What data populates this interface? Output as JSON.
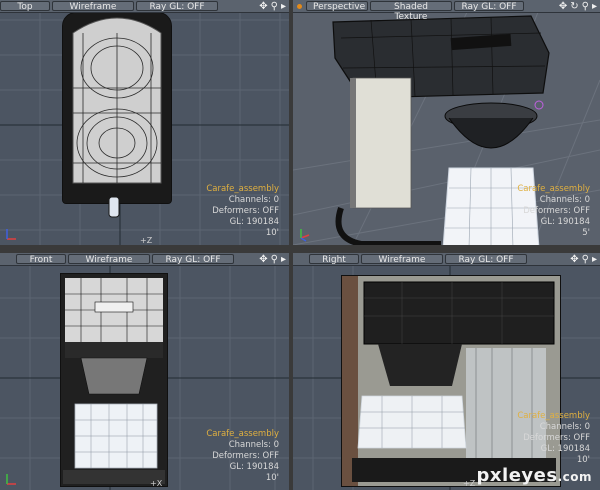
{
  "viewports": [
    {
      "id": "top",
      "view": "Top",
      "shading": "Wireframe",
      "raygl": "Ray GL: OFF",
      "object": "Carafe_assembly",
      "channels": "Channels: 0",
      "deformers": "Deformers: OFF",
      "gl": "GL: 190184",
      "zoom": "10'",
      "corner_axis": "+Z"
    },
    {
      "id": "persp",
      "view": "Perspective",
      "shading": "Shaded Texture",
      "raygl": "Ray GL: OFF",
      "object": "Carafe_assembly",
      "channels": "Channels: 0",
      "deformers": "Deformers: OFF",
      "gl": "GL: 190184",
      "zoom": "5'"
    },
    {
      "id": "front",
      "view": "Front",
      "shading": "Wireframe",
      "raygl": "Ray GL: OFF",
      "object": "Carafe_assembly",
      "channels": "Channels: 0",
      "deformers": "Deformers: OFF",
      "gl": "GL: 190184",
      "zoom": "10'",
      "corner_axis": "+X"
    },
    {
      "id": "right",
      "view": "Right",
      "shading": "Wireframe",
      "raygl": "Ray GL: OFF",
      "object": "Carafe_assembly",
      "channels": "Channels: 0",
      "deformers": "Deformers: OFF",
      "gl": "GL: 190184",
      "zoom": "10'",
      "corner_axis": "+Z"
    }
  ],
  "icons": {
    "move": "move-icon",
    "zoom": "magnifier-icon",
    "rotate": "rotate-icon",
    "arrow": "arrow-right-icon"
  },
  "accent_colors": {
    "object_label": "#e0b040",
    "viewport_bg": "#4c5562"
  },
  "watermark": {
    "brand": "pxleyes",
    "tld": ".com"
  }
}
